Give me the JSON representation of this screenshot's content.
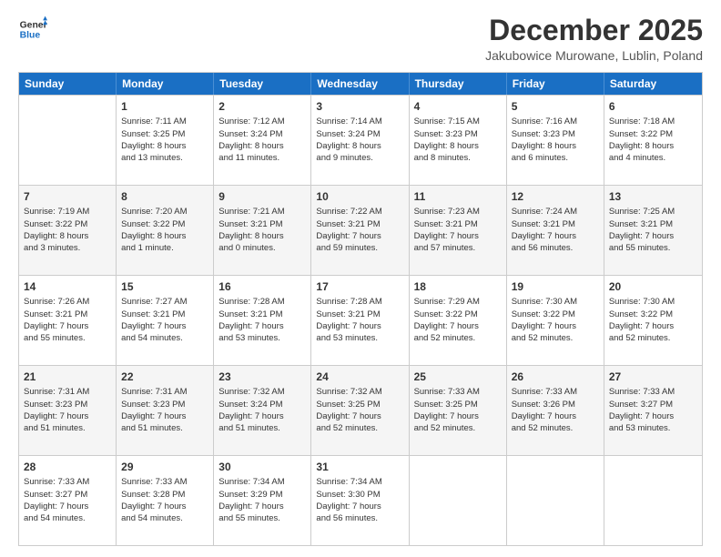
{
  "logo": {
    "line1": "General",
    "line2": "Blue"
  },
  "title": "December 2025",
  "location": "Jakubowice Murowane, Lublin, Poland",
  "header_days": [
    "Sunday",
    "Monday",
    "Tuesday",
    "Wednesday",
    "Thursday",
    "Friday",
    "Saturday"
  ],
  "rows": [
    [
      {
        "day": "",
        "text": ""
      },
      {
        "day": "1",
        "text": "Sunrise: 7:11 AM\nSunset: 3:25 PM\nDaylight: 8 hours\nand 13 minutes."
      },
      {
        "day": "2",
        "text": "Sunrise: 7:12 AM\nSunset: 3:24 PM\nDaylight: 8 hours\nand 11 minutes."
      },
      {
        "day": "3",
        "text": "Sunrise: 7:14 AM\nSunset: 3:24 PM\nDaylight: 8 hours\nand 9 minutes."
      },
      {
        "day": "4",
        "text": "Sunrise: 7:15 AM\nSunset: 3:23 PM\nDaylight: 8 hours\nand 8 minutes."
      },
      {
        "day": "5",
        "text": "Sunrise: 7:16 AM\nSunset: 3:23 PM\nDaylight: 8 hours\nand 6 minutes."
      },
      {
        "day": "6",
        "text": "Sunrise: 7:18 AM\nSunset: 3:22 PM\nDaylight: 8 hours\nand 4 minutes."
      }
    ],
    [
      {
        "day": "7",
        "text": "Sunrise: 7:19 AM\nSunset: 3:22 PM\nDaylight: 8 hours\nand 3 minutes."
      },
      {
        "day": "8",
        "text": "Sunrise: 7:20 AM\nSunset: 3:22 PM\nDaylight: 8 hours\nand 1 minute."
      },
      {
        "day": "9",
        "text": "Sunrise: 7:21 AM\nSunset: 3:21 PM\nDaylight: 8 hours\nand 0 minutes."
      },
      {
        "day": "10",
        "text": "Sunrise: 7:22 AM\nSunset: 3:21 PM\nDaylight: 7 hours\nand 59 minutes."
      },
      {
        "day": "11",
        "text": "Sunrise: 7:23 AM\nSunset: 3:21 PM\nDaylight: 7 hours\nand 57 minutes."
      },
      {
        "day": "12",
        "text": "Sunrise: 7:24 AM\nSunset: 3:21 PM\nDaylight: 7 hours\nand 56 minutes."
      },
      {
        "day": "13",
        "text": "Sunrise: 7:25 AM\nSunset: 3:21 PM\nDaylight: 7 hours\nand 55 minutes."
      }
    ],
    [
      {
        "day": "14",
        "text": "Sunrise: 7:26 AM\nSunset: 3:21 PM\nDaylight: 7 hours\nand 55 minutes."
      },
      {
        "day": "15",
        "text": "Sunrise: 7:27 AM\nSunset: 3:21 PM\nDaylight: 7 hours\nand 54 minutes."
      },
      {
        "day": "16",
        "text": "Sunrise: 7:28 AM\nSunset: 3:21 PM\nDaylight: 7 hours\nand 53 minutes."
      },
      {
        "day": "17",
        "text": "Sunrise: 7:28 AM\nSunset: 3:21 PM\nDaylight: 7 hours\nand 53 minutes."
      },
      {
        "day": "18",
        "text": "Sunrise: 7:29 AM\nSunset: 3:22 PM\nDaylight: 7 hours\nand 52 minutes."
      },
      {
        "day": "19",
        "text": "Sunrise: 7:30 AM\nSunset: 3:22 PM\nDaylight: 7 hours\nand 52 minutes."
      },
      {
        "day": "20",
        "text": "Sunrise: 7:30 AM\nSunset: 3:22 PM\nDaylight: 7 hours\nand 52 minutes."
      }
    ],
    [
      {
        "day": "21",
        "text": "Sunrise: 7:31 AM\nSunset: 3:23 PM\nDaylight: 7 hours\nand 51 minutes."
      },
      {
        "day": "22",
        "text": "Sunrise: 7:31 AM\nSunset: 3:23 PM\nDaylight: 7 hours\nand 51 minutes."
      },
      {
        "day": "23",
        "text": "Sunrise: 7:32 AM\nSunset: 3:24 PM\nDaylight: 7 hours\nand 51 minutes."
      },
      {
        "day": "24",
        "text": "Sunrise: 7:32 AM\nSunset: 3:25 PM\nDaylight: 7 hours\nand 52 minutes."
      },
      {
        "day": "25",
        "text": "Sunrise: 7:33 AM\nSunset: 3:25 PM\nDaylight: 7 hours\nand 52 minutes."
      },
      {
        "day": "26",
        "text": "Sunrise: 7:33 AM\nSunset: 3:26 PM\nDaylight: 7 hours\nand 52 minutes."
      },
      {
        "day": "27",
        "text": "Sunrise: 7:33 AM\nSunset: 3:27 PM\nDaylight: 7 hours\nand 53 minutes."
      }
    ],
    [
      {
        "day": "28",
        "text": "Sunrise: 7:33 AM\nSunset: 3:27 PM\nDaylight: 7 hours\nand 54 minutes."
      },
      {
        "day": "29",
        "text": "Sunrise: 7:33 AM\nSunset: 3:28 PM\nDaylight: 7 hours\nand 54 minutes."
      },
      {
        "day": "30",
        "text": "Sunrise: 7:34 AM\nSunset: 3:29 PM\nDaylight: 7 hours\nand 55 minutes."
      },
      {
        "day": "31",
        "text": "Sunrise: 7:34 AM\nSunset: 3:30 PM\nDaylight: 7 hours\nand 56 minutes."
      },
      {
        "day": "",
        "text": ""
      },
      {
        "day": "",
        "text": ""
      },
      {
        "day": "",
        "text": ""
      }
    ]
  ]
}
